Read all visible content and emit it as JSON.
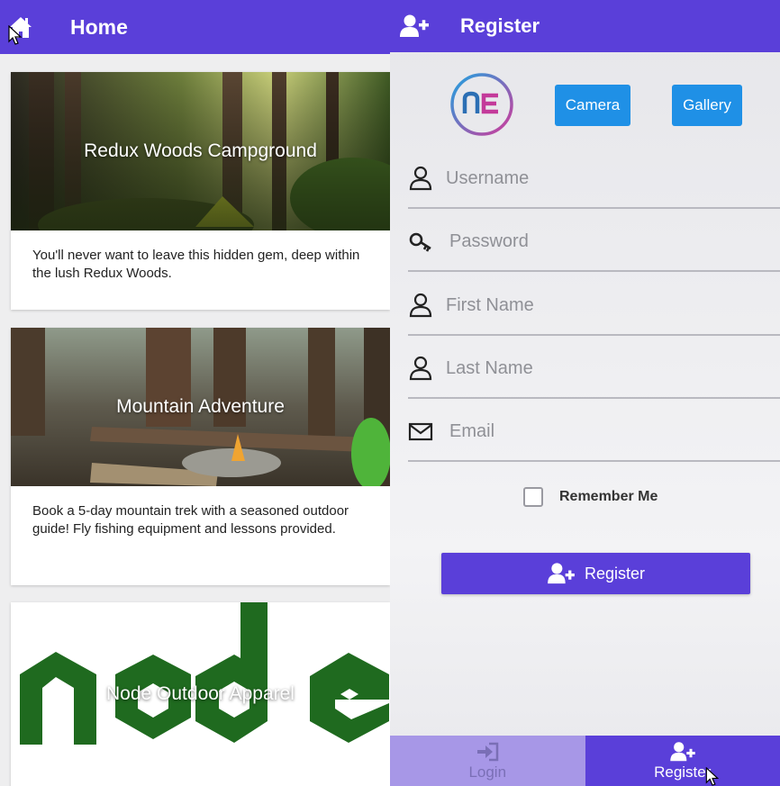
{
  "home": {
    "title": "Home",
    "cards": [
      {
        "title": "Redux Woods Campground",
        "description": "You'll never want to leave this hidden gem, deep within the lush Redux Woods."
      },
      {
        "title": "Mountain Adventure",
        "description": "Book a 5-day mountain trek with a seasoned outdoor guide! Fly fishing equipment and lessons provided."
      },
      {
        "title": "Node Outdoor Apparel"
      }
    ]
  },
  "register": {
    "title": "Register",
    "buttons": {
      "camera": "Camera",
      "gallery": "Gallery",
      "submit": "Register"
    },
    "fields": {
      "username": "Username",
      "password": "Password",
      "first_name": "First Name",
      "last_name": "Last Name",
      "email": "Email"
    },
    "remember_me": "Remember Me",
    "tabs": {
      "login": "Login",
      "register": "Register"
    }
  },
  "colors": {
    "primary": "#5a3fd9",
    "accent": "#1f90e6",
    "tab_inactive": "#a797e7"
  },
  "icons": {
    "home": "home-icon",
    "add_user": "add-user-icon",
    "person": "person-icon",
    "key": "key-icon",
    "envelope": "envelope-icon",
    "sign_in": "sign-in-icon",
    "logo": "nc-logo"
  }
}
